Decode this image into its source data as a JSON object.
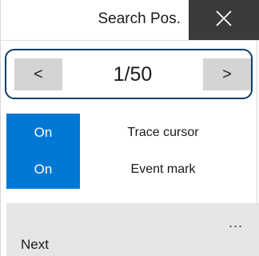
{
  "window": {
    "title": "Search Pos.",
    "close_icon": "close-icon"
  },
  "pager": {
    "prev_label": "<",
    "next_label": ">",
    "current_page": 1,
    "total_pages": 50,
    "indicator": "1/50",
    "outline_color": "#0a3d6b"
  },
  "options": [
    {
      "state": "On",
      "label": "Trace cursor"
    },
    {
      "state": "On",
      "label": "Event mark"
    }
  ],
  "command_bar": {
    "more_label": "...",
    "next_label": "Next"
  },
  "colors": {
    "accent": "#0078d4",
    "close_button_bg": "#3b3b3b",
    "nav_button_bg": "#d4d4d4",
    "command_bar_bg": "#e6e6e6"
  }
}
